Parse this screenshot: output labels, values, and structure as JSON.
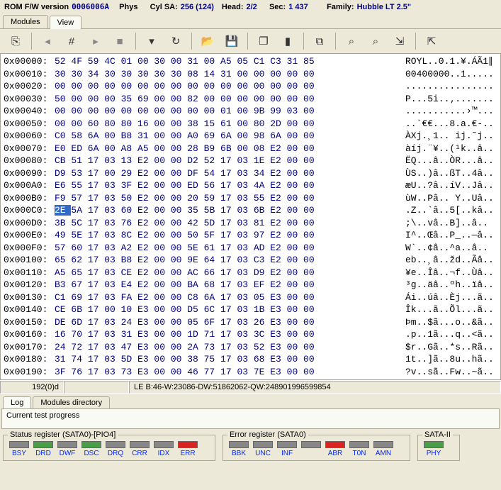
{
  "header": {
    "rom_label": "ROM F/W version",
    "rom_value": "0006006A",
    "phys_label": "Phys",
    "cyl_label": "Cyl SA:",
    "cyl_value": "256 (124)",
    "head_label": "Head:",
    "head_value": "2/2",
    "sec_label": "Sec:",
    "sec_value": "1 437",
    "family_label": "Family:",
    "family_value": "Hubble LT 2.5\""
  },
  "top_tabs": [
    "Modules",
    "View"
  ],
  "toolbar_icons": [
    "refresh-icon",
    "back-icon",
    "grid-icon",
    "forward-icon",
    "stop-icon",
    "dropdown-icon",
    "reload-icon",
    "open-icon",
    "save-icon",
    "copy-icon",
    "paste-icon",
    "compare-icon",
    "find-icon",
    "find-next-icon",
    "export-icon",
    "import-icon"
  ],
  "hex": {
    "rows": [
      {
        "addr": "0x00000:",
        "bytes": "52 4F 59 4C 01 00 30 00 31 00 A5 05 C1 C3 31 85",
        "ascii": "ROYL..0.1.¥.ÁÃ1∥"
      },
      {
        "addr": "0x00010:",
        "bytes": "30 30 34 30 30 30 30 30 08 14 31 00 00 00 00 00",
        "ascii": "00400000..1....."
      },
      {
        "addr": "0x00020:",
        "bytes": "00 00 00 00 00 00 00 00 00 00 00 00 00 00 00 00",
        "ascii": "................"
      },
      {
        "addr": "0x00030:",
        "bytes": "50 00 00 00 35 69 00 00 82 00 00 00 00 00 00 00",
        "ascii": "P...5i..‚......."
      },
      {
        "addr": "0x00040:",
        "bytes": "00 00 00 00 00 00 00 00 00 00 01 00 9B 99 03 00",
        "ascii": "...........›™..."
      },
      {
        "addr": "0x00050:",
        "bytes": "00 00 60 80 80 16 00 00 38 15 61 00 80 2D 00 00",
        "ascii": "..`€€...8.a.€-.."
      },
      {
        "addr": "0x00060:",
        "bytes": "C0 58 6A 00 B8 31 00 00 A0 69 6A 00 98 6A 00 00",
        "ascii": "ÀXj.¸1.. ij.˜j.."
      },
      {
        "addr": "0x00070:",
        "bytes": "E0 ED 6A 00 A8 A5 00 00 28 B9 6B 00 08 E2 00 00",
        "ascii": "àíj.¨¥..(¹k..â.."
      },
      {
        "addr": "0x00080:",
        "bytes": "CB 51 17 03 13 E2 00 00 D2 52 17 03 1E E2 00 00",
        "ascii": "ËQ...â..ÒR...â.."
      },
      {
        "addr": "0x00090:",
        "bytes": "D9 53 17 00 29 E2 00 00 DF 54 17 03 34 E2 00 00",
        "ascii": "ÙS..)â..ßT..4â.."
      },
      {
        "addr": "0x000A0:",
        "bytes": "E6 55 17 03 3F E2 00 00 ED 56 17 03 4A E2 00 00",
        "ascii": "æU..?â..íV..Jâ.."
      },
      {
        "addr": "0x000B0:",
        "bytes": "F9 57 17 03 50 E2 00 00 20 59 17 03 55 E2 00 00",
        "ascii": "ùW..Pâ.. Y..Uâ.."
      },
      {
        "addr": "0x000C0:",
        "bytes": "2E 5A 17 03 60 E2 00 00 35 5B 17 03 6B E2 00 00",
        "ascii": ".Z..`â..5[..kâ..",
        "sel": 0
      },
      {
        "addr": "0x000D0:",
        "bytes": "3B 5C 17 03 76 E2 00 00 42 5D 17 03 81 E2 00 00",
        "ascii": ";\\..vâ..B]..â.."
      },
      {
        "addr": "0x000E0:",
        "bytes": "49 5E 17 03 8C E2 00 00 50 5F 17 03 97 E2 00 00",
        "ascii": "I^..Œâ..P_..—â.."
      },
      {
        "addr": "0x000F0:",
        "bytes": "57 60 17 03 A2 E2 00 00 5E 61 17 03 AD E2 00 00",
        "ascii": "W`..¢â..^a..­â.."
      },
      {
        "addr": "0x00100:",
        "bytes": "65 62 17 03 B8 E2 00 00 9E 64 17 03 C3 E2 00 00",
        "ascii": "eb..¸â..žd..Ãâ.."
      },
      {
        "addr": "0x00110:",
        "bytes": "A5 65 17 03 CE E2 00 00 AC 66 17 03 D9 E2 00 00",
        "ascii": "¥e..Îâ..¬f..Ùâ.."
      },
      {
        "addr": "0x00120:",
        "bytes": "B3 67 17 03 E4 E2 00 00 BA 68 17 03 EF E2 00 00",
        "ascii": "³g..äâ..ºh..ïâ.."
      },
      {
        "addr": "0x00130:",
        "bytes": "C1 69 17 03 FA E2 00 00 C8 6A 17 03 05 E3 00 00",
        "ascii": "Ái..úâ..Èj...ã.."
      },
      {
        "addr": "0x00140:",
        "bytes": "CE 6B 17 00 10 E3 00 00 D5 6C 17 03 1B E3 00 00",
        "ascii": "Îk...ã..Õl...ã.."
      },
      {
        "addr": "0x00150:",
        "bytes": "DE 6D 17 03 24 E3 00 00 05 6F 17 03 26 E3 00 00",
        "ascii": "Þm..$ã...o..&ã.."
      },
      {
        "addr": "0x00160:",
        "bytes": "16 70 17 03 31 E3 00 00 1D 71 17 03 3C E3 00 00",
        "ascii": ".p..1ã...q..<ã.."
      },
      {
        "addr": "0x00170:",
        "bytes": "24 72 17 03 47 E3 00 00 2A 73 17 03 52 E3 00 00",
        "ascii": "$r..Gã..*s..Rã.."
      },
      {
        "addr": "0x00180:",
        "bytes": "31 74 17 03 5D E3 00 00 38 75 17 03 68 E3 00 00",
        "ascii": "1t..]ã..8u..hã.."
      },
      {
        "addr": "0x00190:",
        "bytes": "3F 76 17 03 73 E3 00 00 46 77 17 03 7E E3 00 00",
        "ascii": "?v..sã..Fw..~ã.."
      }
    ]
  },
  "status": {
    "left": "192(0)d",
    "right": "LE B:46-W:23086-DW:51862062-QW:248901996599854"
  },
  "bottom_tabs": [
    "Log",
    "Modules directory"
  ],
  "progress_label": "Current test progress",
  "status_register": {
    "title": "Status register (SATA0)-[PIO4]",
    "leds": [
      {
        "name": "BSY",
        "state": "off"
      },
      {
        "name": "DRD",
        "state": "green"
      },
      {
        "name": "DWF",
        "state": "off"
      },
      {
        "name": "DSC",
        "state": "green"
      },
      {
        "name": "DRQ",
        "state": "off"
      },
      {
        "name": "CRR",
        "state": "off"
      },
      {
        "name": "IDX",
        "state": "off"
      },
      {
        "name": "ERR",
        "state": "red"
      }
    ]
  },
  "error_register": {
    "title": "Error register (SATA0)",
    "leds": [
      {
        "name": "BBK",
        "state": "off"
      },
      {
        "name": "UNC",
        "state": "off"
      },
      {
        "name": "INF",
        "state": "off"
      },
      {
        "name": "",
        "state": "off"
      },
      {
        "name": "ABR",
        "state": "red"
      },
      {
        "name": "T0N",
        "state": "off"
      },
      {
        "name": "AMN",
        "state": "off"
      }
    ]
  },
  "sata_group": {
    "title": "SATA-II",
    "leds": [
      {
        "name": "PHY",
        "state": "green"
      }
    ]
  }
}
